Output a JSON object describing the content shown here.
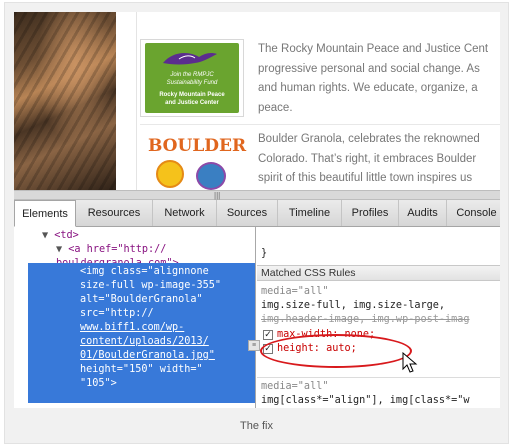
{
  "webpage": {
    "logo1": {
      "line1": "Join the RMPJC",
      "line2": "Sustainability Fund",
      "line3": "Rocky Mountain Peace",
      "line4": "and Justice Center"
    },
    "logo2": {
      "wordmark": "BOULDER"
    },
    "paragraph1": [
      "The Rocky Mountain Peace and Justice Cent",
      "progressive personal and social change. As",
      "and human rights. We educate, organize, a",
      "peace."
    ],
    "paragraph2": [
      "Boulder Granola, celebrates the reknowned",
      "Colorado. That’s right, it embraces Boulder",
      "spirit of this beautiful little town inspires us"
    ]
  },
  "devtools": {
    "tabs": [
      "Elements",
      "Resources",
      "Network",
      "Sources",
      "Timeline",
      "Profiles",
      "Audits",
      "Console"
    ],
    "active_tab": "Elements",
    "dom": {
      "td_line": "<td>",
      "a_line1": "<a href=\"http://",
      "a_line2": "bouldergranola.com\">",
      "img_lines": [
        "<img class=\"alignnone",
        "size-full wp-image-355\"",
        "alt=\"BoulderGranola\"",
        "src=\"http://",
        "www.biff1.com/wp-",
        "content/uploads/2013/",
        "01/BoulderGranola.jpg\"",
        "height=\"150\" width=\"",
        "\"105\">"
      ]
    },
    "styles": {
      "brace": "}",
      "matched_header": "Matched CSS Rules",
      "media1": "media=\"all\"",
      "selector1a": "img.size-full, img.size-large,",
      "selector1b": "img.header-image, img.wp-post-imag",
      "prop1": "max-width: none;",
      "prop2": "height: auto;",
      "media2": "media=\"all\"",
      "selector2": "img[class*=\"align\"], img[class*=\"w"
    }
  },
  "caption": "The fix",
  "colors": {
    "selection": "#3879d9",
    "highlight_ellipse": "#d8191c",
    "logo_green": "#6aa42f"
  }
}
